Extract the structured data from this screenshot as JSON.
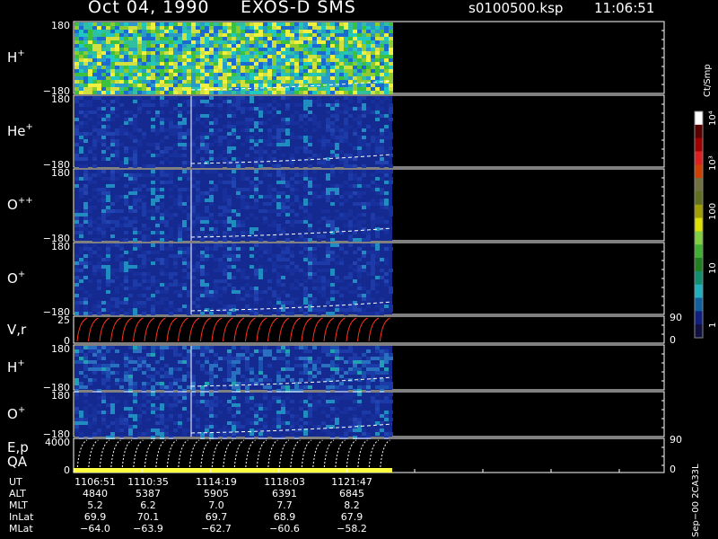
{
  "header": {
    "date": "Oct 04, 1990",
    "instrument": "EXOS-D SMS",
    "file": "s0100500.ksp",
    "time": "11:06:51"
  },
  "colors": {
    "background": "#000000",
    "panel_bg": "#1a2a8c",
    "axis": "#ffffff",
    "dashed_curve": "#ffffff",
    "red_curve": "#ff3020",
    "qa_bar": "#ffff40"
  },
  "colorbar": {
    "unit_label": "Ct/Smp",
    "tick_labels": [
      "10⁴",
      "10³",
      "100",
      "10",
      "1"
    ]
  },
  "chart_data": [
    {
      "type": "heatmap",
      "panel": "H+",
      "label": "H",
      "sup": "+",
      "ylim": [
        -180,
        180
      ],
      "y_top_label": "180",
      "y_bottom_label": "−180",
      "style": "bright"
    },
    {
      "type": "heatmap",
      "panel": "He+",
      "label": "He",
      "sup": "+",
      "ylim": [
        -180,
        180
      ],
      "y_top_label": "180",
      "y_bottom_label": "−180",
      "style": "dim"
    },
    {
      "type": "heatmap",
      "panel": "O++",
      "label": "O",
      "sup": "++",
      "ylim": [
        -180,
        180
      ],
      "y_top_label": "180",
      "y_bottom_label": "−180",
      "style": "dim"
    },
    {
      "type": "heatmap",
      "panel": "O+",
      "label": "O",
      "sup": "+",
      "ylim": [
        -180,
        180
      ],
      "y_top_label": "180",
      "y_bottom_label": "−180",
      "style": "dim"
    },
    {
      "type": "line",
      "panel": "V,r",
      "label": "V,r",
      "ylim": [
        0,
        25
      ],
      "y_top_label": "25",
      "y_bottom_label": "0",
      "right_top_label": "90",
      "right_bottom_label": "0"
    },
    {
      "type": "heatmap",
      "panel": "H+ (low)",
      "label": "H",
      "sup": "+",
      "ylim": [
        -180,
        180
      ],
      "y_top_label": "180",
      "y_bottom_label": "−180",
      "style": "mixed"
    },
    {
      "type": "heatmap",
      "panel": "O+ (low)",
      "label": "O",
      "sup": "+",
      "ylim": [
        -180,
        180
      ],
      "y_top_label": "180",
      "y_bottom_label": "−180",
      "style": "dim"
    },
    {
      "type": "line",
      "panel": "E,p QA",
      "label": "E,p",
      "label2": "QA",
      "ylim": [
        0,
        4000
      ],
      "y_top_label": "4000",
      "y_bottom_label": "0",
      "right_top_label": "90",
      "right_bottom_label": "0"
    }
  ],
  "ephemeris": {
    "row_labels": [
      "UT",
      "ALT",
      "MLT",
      "InLat",
      "MLat"
    ],
    "columns": [
      {
        "UT": "1106:51",
        "ALT": "4840",
        "MLT": "5.2",
        "InLat": "69.9",
        "MLat": "−64.0"
      },
      {
        "UT": "1110:35",
        "ALT": "5387",
        "MLT": "6.2",
        "InLat": "70.1",
        "MLat": "−63.9"
      },
      {
        "UT": "1114:19",
        "ALT": "5905",
        "MLT": "7.0",
        "InLat": "69.7",
        "MLat": "−62.7"
      },
      {
        "UT": "1118:03",
        "ALT": "6391",
        "MLT": "7.7",
        "InLat": "68.9",
        "MLat": "−60.6"
      },
      {
        "UT": "1121:47",
        "ALT": "6845",
        "MLT": "8.2",
        "InLat": "67.9",
        "MLat": "−58.2"
      }
    ]
  },
  "footer_note": "Sep−00 2CA33L"
}
